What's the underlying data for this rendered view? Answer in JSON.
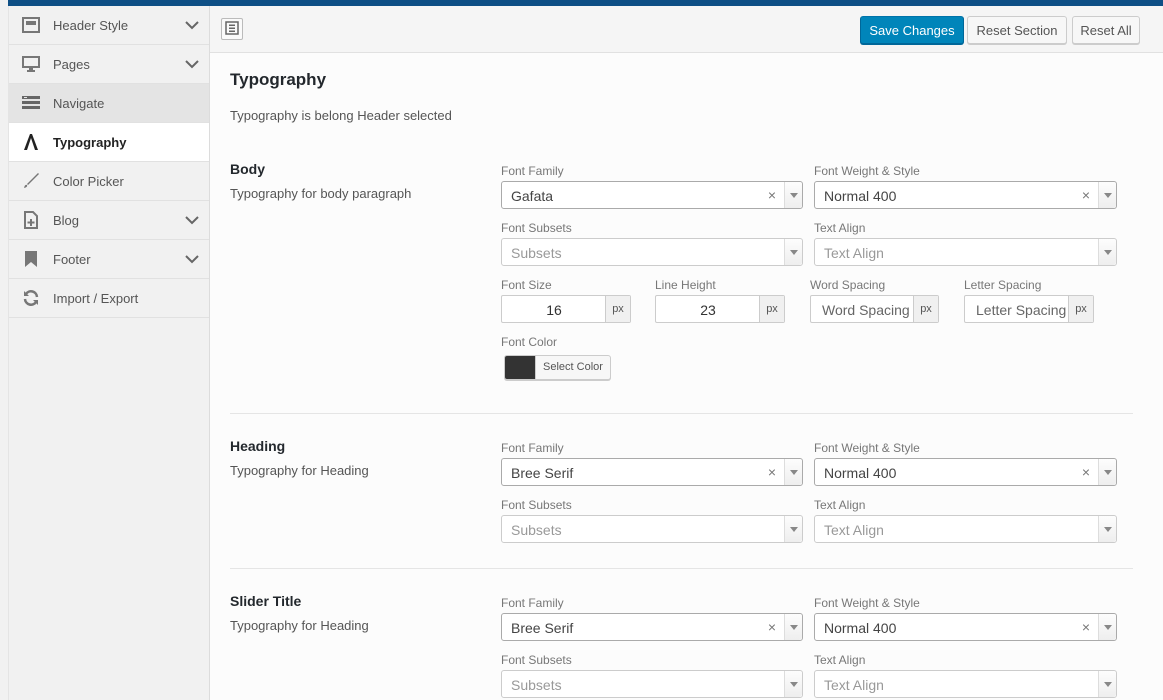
{
  "sidebar": {
    "items": [
      {
        "label": "Header Style",
        "icon": "header-layout-icon",
        "has_chevron": true
      },
      {
        "label": "Pages",
        "icon": "monitor-icon",
        "has_chevron": true
      },
      {
        "label": "Navigate",
        "icon": "menu-lines-icon",
        "has_chevron": false,
        "state": "hover"
      },
      {
        "label": "Typography",
        "icon": "typography-a-icon",
        "has_chevron": false,
        "state": "active"
      },
      {
        "label": "Color Picker",
        "icon": "brush-icon",
        "has_chevron": false
      },
      {
        "label": "Blog",
        "icon": "add-page-icon",
        "has_chevron": true
      },
      {
        "label": "Footer",
        "icon": "bookmark-icon",
        "has_chevron": true
      },
      {
        "label": "Import / Export",
        "icon": "refresh-icon",
        "has_chevron": false
      }
    ]
  },
  "toolbar": {
    "save_label": "Save Changes",
    "reset_section_label": "Reset Section",
    "reset_all_label": "Reset All"
  },
  "page": {
    "title": "Typography",
    "description": "Typography is belong Header selected"
  },
  "labels": {
    "font_family": "Font Family",
    "font_weight_style": "Font Weight & Style",
    "font_subsets": "Font Subsets",
    "text_align": "Text Align",
    "font_size": "Font Size",
    "line_height": "Line Height",
    "word_spacing": "Word Spacing",
    "letter_spacing": "Letter Spacing",
    "font_color": "Font Color",
    "subsets_placeholder": "Subsets",
    "text_align_placeholder": "Text Align",
    "word_spacing_placeholder": "Word Spacing",
    "letter_spacing_placeholder": "Letter Spacing",
    "unit_px": "px",
    "select_color": "Select Color",
    "clear_glyph": "×"
  },
  "sections": {
    "body": {
      "title": "Body",
      "description": "Typography for body paragraph",
      "font_family": "Gafata",
      "font_weight": "Normal 400",
      "font_size": "16",
      "line_height": "23",
      "font_color": "#333333"
    },
    "heading": {
      "title": "Heading",
      "description": "Typography for Heading",
      "font_family": "Bree Serif",
      "font_weight": "Normal 400"
    },
    "slider_title": {
      "title": "Slider Title",
      "description": "Typography for Heading",
      "font_family": "Bree Serif",
      "font_weight": "Normal 400"
    }
  },
  "colors": {
    "topbar": "#0e4f85",
    "primary_button": "#0085ba"
  }
}
